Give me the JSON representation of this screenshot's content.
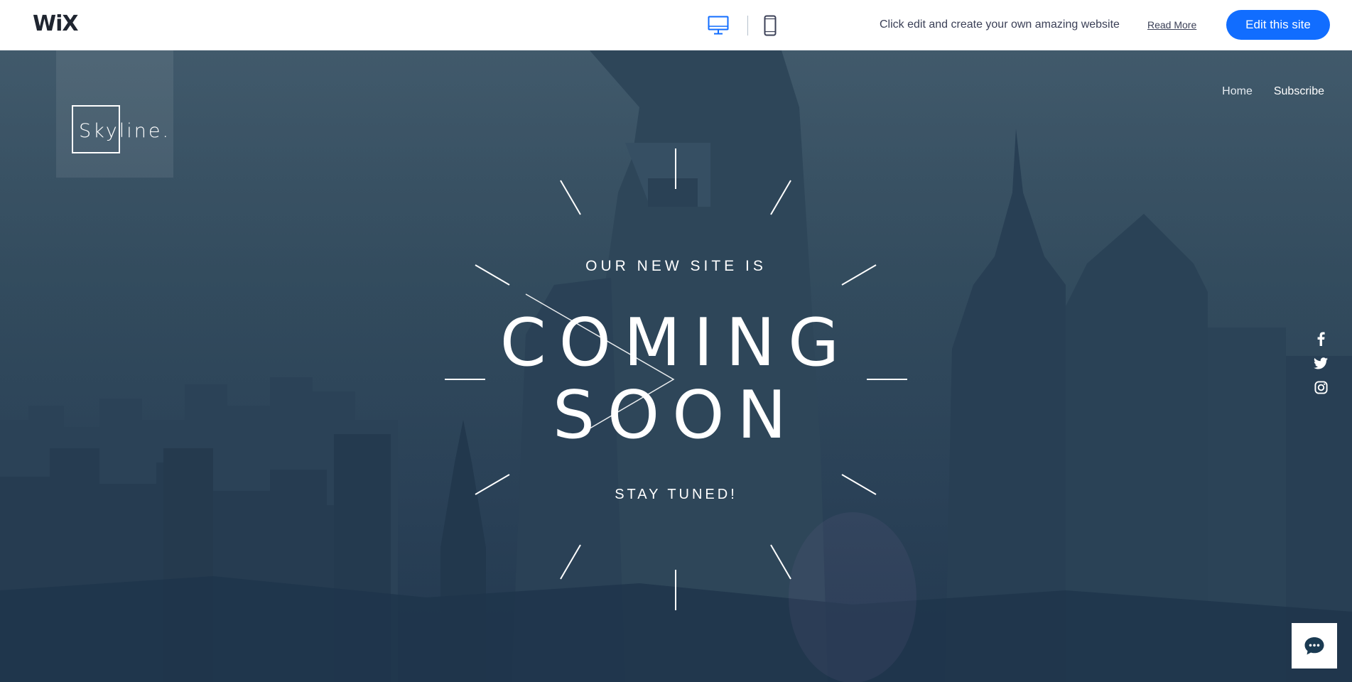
{
  "topbar": {
    "brand": "WiX",
    "icons": [
      "desktop-icon",
      "mobile-icon"
    ],
    "message": "Click edit and create your own amazing website",
    "read_more": "Read More",
    "edit_button": "Edit this site",
    "accent_color": "#116dff"
  },
  "site": {
    "logo_text": "Skyline.",
    "nav": [
      {
        "label": "Home"
      },
      {
        "label": "Subscribe"
      }
    ],
    "kicker": "OUR NEW SITE IS",
    "headline_line1": "COMING",
    "headline_line2": "SOON",
    "tagline": "STAY TUNED!",
    "social_icons": [
      "facebook-icon",
      "twitter-icon",
      "instagram-icon"
    ],
    "chat_icon": "chat-icon",
    "background_color": "#2e465a"
  }
}
